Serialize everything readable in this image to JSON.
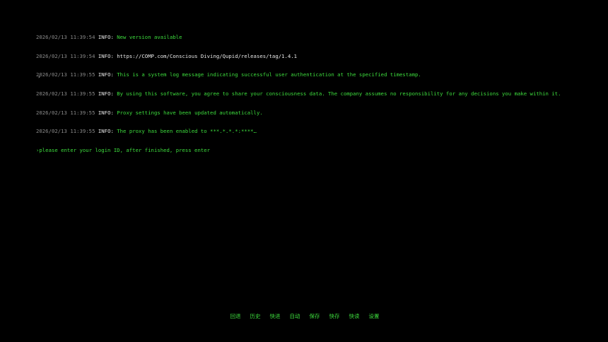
{
  "log": [
    {
      "timestamp": "2026/02/13 11:39:54",
      "level": "INFO:",
      "message": "New version available",
      "color": "#3ddc3d"
    },
    {
      "timestamp": "2026/02/13 11:39:54",
      "level": "INFO:",
      "message": "https://COMP.com/Conscious Diving/Qupid/releases/tag/1.4.1",
      "color": "#e8e8e8"
    },
    {
      "timestamp": "2026/02/13 11:39:55",
      "level": "INFO:",
      "message": "This is a system log message indicating successful user authentication at the specified timestamp.",
      "color": "#3ddc3d"
    },
    {
      "timestamp": "2026/02/13 11:39:55",
      "level": "INFO:",
      "message": "By using this software, you agree to share your consciousness data. The company assumes no responsibility for any decisions you make within it.",
      "color": "#3ddc3d"
    },
    {
      "timestamp": "2026/02/13 11:39:55",
      "level": "INFO:",
      "message": "Proxy settings have been updated automatically.",
      "color": "#3ddc3d"
    },
    {
      "timestamp": "2026/02/13 11:39:55",
      "level": "INFO:",
      "message": "The proxy has been enabled to ***.*.*.*:****…",
      "color": "#3ddc3d"
    }
  ],
  "prompt": "›please enter your login ID, after finished, press enter",
  "input": {
    "caret": "›",
    "value": ""
  },
  "menu": [
    "回退",
    "历史",
    "快进",
    "自动",
    "保存",
    "快存",
    "快读",
    "设置"
  ],
  "colors": {
    "background": "#000000",
    "accent": "#3ddc3d",
    "timestamp": "#8a8a8a",
    "level": "#e8e8e8"
  }
}
